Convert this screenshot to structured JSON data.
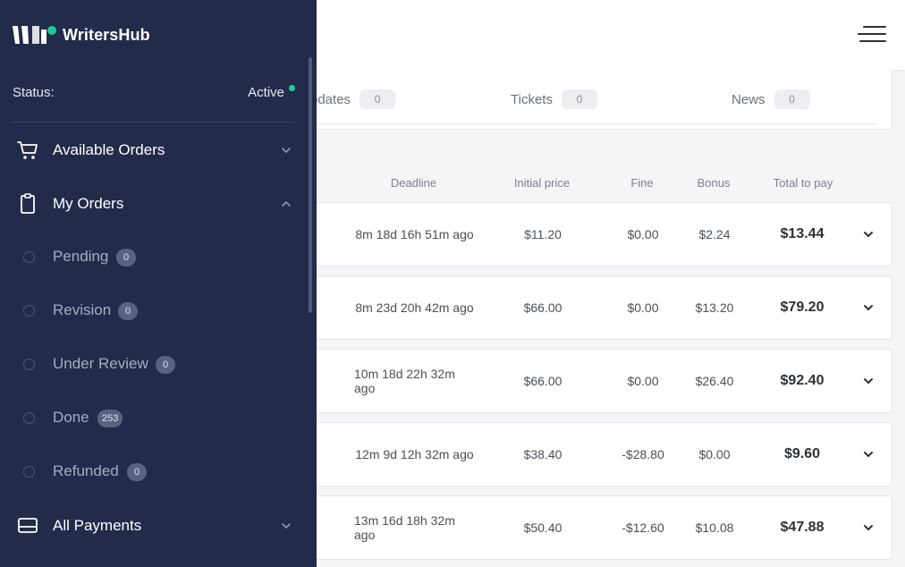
{
  "app": {
    "name": "WritersHub"
  },
  "sidebar": {
    "status_label": "Status:",
    "status_value": "Active",
    "status_color": "#20c997",
    "nav": {
      "available_orders": {
        "label": "Available Orders",
        "icon": "cart-icon",
        "expanded": false
      },
      "my_orders": {
        "label": "My Orders",
        "icon": "clipboard-icon",
        "expanded": true
      },
      "all_payments": {
        "label": "All Payments",
        "icon": "card-icon",
        "expanded": false
      }
    },
    "my_orders_items": [
      {
        "label": "Pending",
        "count": "0"
      },
      {
        "label": "Revision",
        "count": "0"
      },
      {
        "label": "Under Review",
        "count": "0"
      },
      {
        "label": "Done",
        "count": "253"
      },
      {
        "label": "Refunded",
        "count": "0"
      }
    ]
  },
  "stats": {
    "updates": {
      "label": "pdates",
      "count": "0"
    },
    "tickets": {
      "label": "Tickets",
      "count": "0"
    },
    "news": {
      "label": "News",
      "count": "0"
    }
  },
  "table": {
    "headers": {
      "deadline": "Deadline",
      "initial_price": "Initial price",
      "fine": "Fine",
      "bonus": "Bonus",
      "total": "Total to pay"
    },
    "rows": [
      {
        "deadline": "8m 18d 16h 51m ago",
        "initial_price": "$11.20",
        "fine": "$0.00",
        "bonus": "$2.24",
        "total": "$13.44"
      },
      {
        "deadline": "8m 23d 20h 42m ago",
        "initial_price": "$66.00",
        "fine": "$0.00",
        "bonus": "$13.20",
        "total": "$79.20"
      },
      {
        "deadline": "10m 18d 22h 32m ago",
        "initial_price": "$66.00",
        "fine": "$0.00",
        "bonus": "$26.40",
        "total": "$92.40"
      },
      {
        "deadline": "12m 9d 12h 32m ago",
        "initial_price": "$38.40",
        "fine": "-$28.80",
        "bonus": "$0.00",
        "total": "$9.60"
      },
      {
        "deadline": "13m 16d 18h 32m ago",
        "initial_price": "$50.40",
        "fine": "-$12.60",
        "bonus": "$10.08",
        "total": "$47.88"
      }
    ]
  },
  "colors": {
    "sidebar_bg": "#232b4a",
    "accent": "#20c997",
    "badge_bg": "#5a6281"
  }
}
